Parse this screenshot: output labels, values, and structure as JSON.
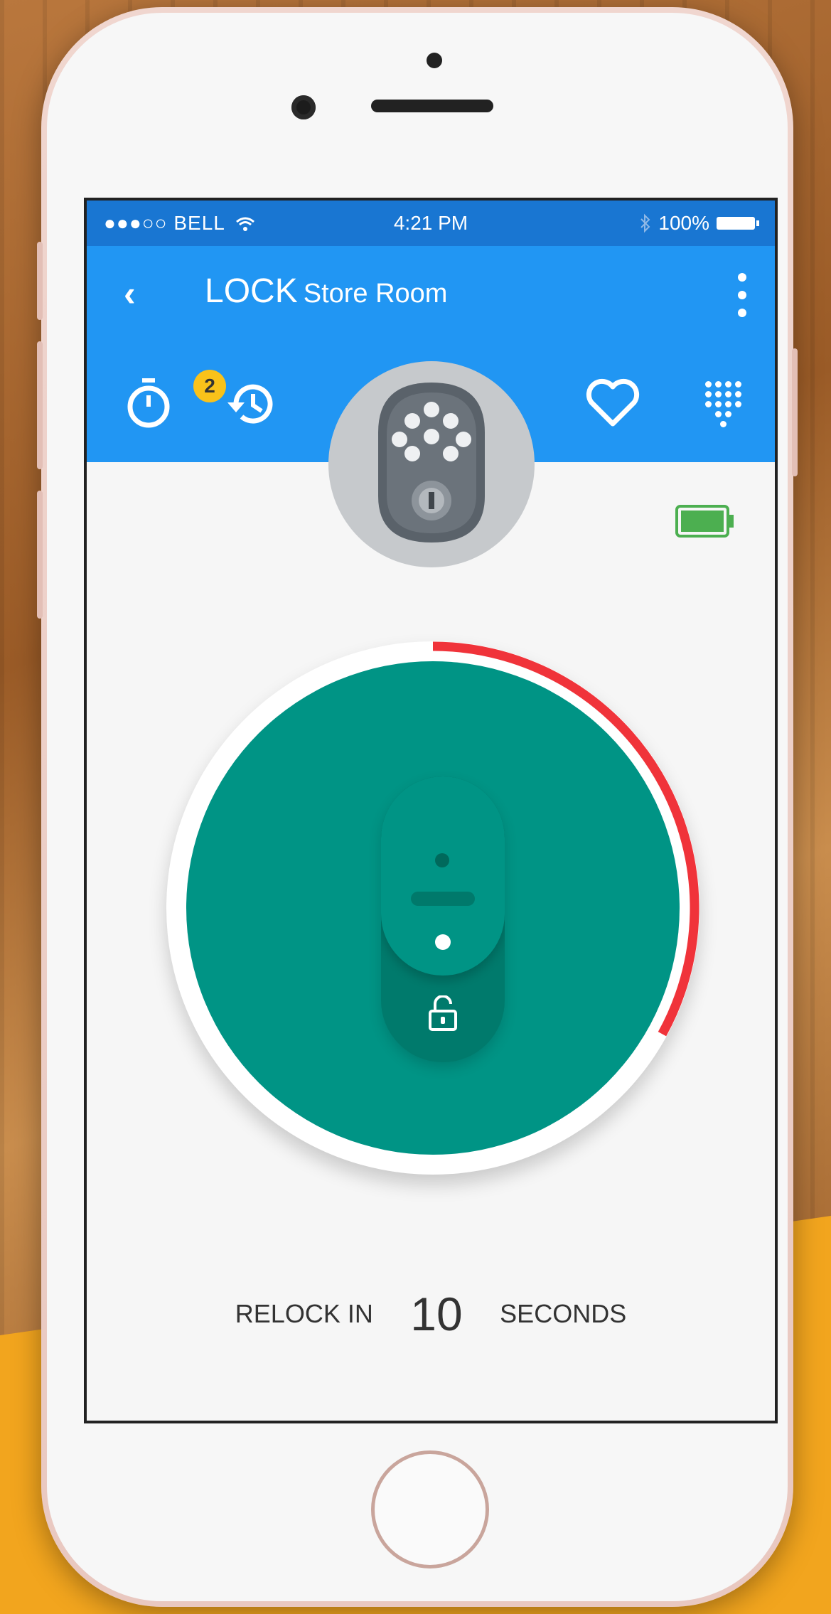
{
  "status_bar": {
    "carrier": "●●●○○ BELL",
    "time": "4:21 PM",
    "battery": "100%"
  },
  "app_bar": {
    "title": "LOCK",
    "subtitle": "Store Room"
  },
  "toolbar": {
    "timer_badge": "2"
  },
  "relock": {
    "prefix": "RELOCK IN",
    "seconds": "10",
    "suffix": "SECONDS"
  },
  "relock_progress": 0.33,
  "colors": {
    "primary": "#2196f3",
    "status_bar": "#1976d2",
    "lock_teal": "#009485",
    "progress_red": "#f0333a",
    "battery_green": "#4caf50",
    "badge_yellow": "#f9c21a"
  },
  "icons": [
    "back-icon",
    "more-icon",
    "timer-icon",
    "history-icon",
    "favorite-icon",
    "keypad-icon",
    "battery-icon",
    "unlock-icon",
    "wifi-icon",
    "bluetooth-icon"
  ]
}
